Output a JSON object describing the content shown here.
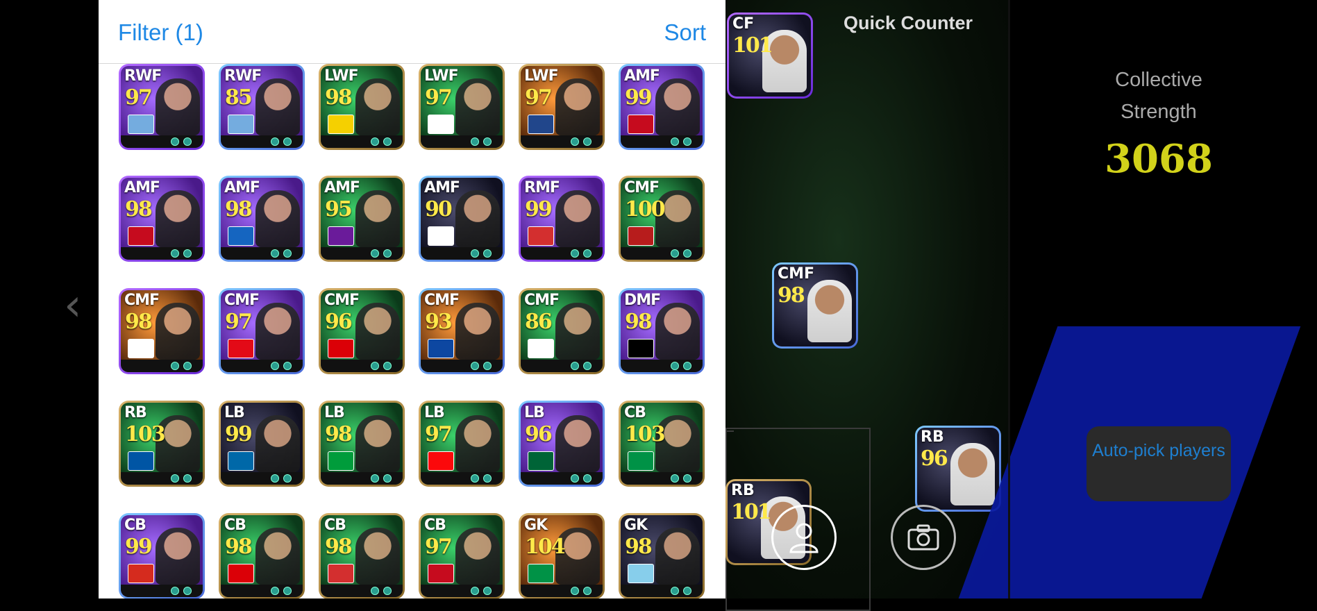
{
  "header": {
    "filter_label": "Filter (1)",
    "sort_label": "Sort"
  },
  "back_glyph": "‹",
  "grid": [
    {
      "pos": "RWF",
      "rating": "97",
      "frame": "purple",
      "bg": "purple",
      "badge": "#74acdf"
    },
    {
      "pos": "RWF",
      "rating": "85",
      "frame": "blue",
      "bg": "purple",
      "badge": "#74acdf"
    },
    {
      "pos": "LWF",
      "rating": "98",
      "frame": "gold",
      "bg": "green",
      "badge": "#f5d000"
    },
    {
      "pos": "LWF",
      "rating": "97",
      "frame": "gold",
      "bg": "green",
      "badge": "#ffffff"
    },
    {
      "pos": "LWF",
      "rating": "97",
      "frame": "gold",
      "bg": "orange",
      "badge": "#21468b"
    },
    {
      "pos": "AMF",
      "rating": "99",
      "frame": "blue",
      "bg": "purple",
      "badge": "#c60b1e"
    },
    {
      "pos": "AMF",
      "rating": "98",
      "frame": "purple",
      "bg": "purple",
      "badge": "#c60b1e"
    },
    {
      "pos": "AMF",
      "rating": "98",
      "frame": "blue",
      "bg": "purple",
      "badge": "#1565c0"
    },
    {
      "pos": "AMF",
      "rating": "95",
      "frame": "gold",
      "bg": "green",
      "badge": "#6a1b9a"
    },
    {
      "pos": "AMF",
      "rating": "90",
      "frame": "blue",
      "bg": "dark",
      "badge": "#ffffff"
    },
    {
      "pos": "RMF",
      "rating": "99",
      "frame": "purple",
      "bg": "purple",
      "badge": "#d32f2f"
    },
    {
      "pos": "CMF",
      "rating": "100",
      "frame": "gold",
      "bg": "green",
      "badge": "#b71c1c"
    },
    {
      "pos": "CMF",
      "rating": "98",
      "frame": "purple",
      "bg": "orange",
      "badge": "#ffffff"
    },
    {
      "pos": "CMF",
      "rating": "97",
      "frame": "blue",
      "bg": "purple",
      "badge": "#e30a17"
    },
    {
      "pos": "CMF",
      "rating": "96",
      "frame": "gold",
      "bg": "green",
      "badge": "#db0007"
    },
    {
      "pos": "CMF",
      "rating": "93",
      "frame": "blue",
      "bg": "orange",
      "badge": "#0d47a1"
    },
    {
      "pos": "CMF",
      "rating": "86",
      "frame": "gold",
      "bg": "green",
      "badge": "#ffffff"
    },
    {
      "pos": "DMF",
      "rating": "98",
      "frame": "blue",
      "bg": "purple",
      "badge": "#000000"
    },
    {
      "pos": "RB",
      "rating": "103",
      "frame": "gold",
      "bg": "green",
      "badge": "#0055a4"
    },
    {
      "pos": "LB",
      "rating": "99",
      "frame": "gold",
      "bg": "dark",
      "badge": "#0068a8"
    },
    {
      "pos": "LB",
      "rating": "98",
      "frame": "gold",
      "bg": "green",
      "badge": "#009c3b"
    },
    {
      "pos": "LB",
      "rating": "97",
      "frame": "gold",
      "bg": "green",
      "badge": "#fb090b"
    },
    {
      "pos": "LB",
      "rating": "96",
      "frame": "blue",
      "bg": "purple",
      "badge": "#006437"
    },
    {
      "pos": "CB",
      "rating": "103",
      "frame": "gold",
      "bg": "green",
      "badge": "#009246"
    },
    {
      "pos": "CB",
      "rating": "99",
      "frame": "blue",
      "bg": "purple",
      "badge": "#d52b1e"
    },
    {
      "pos": "CB",
      "rating": "98",
      "frame": "gold",
      "bg": "green",
      "badge": "#db0007"
    },
    {
      "pos": "CB",
      "rating": "98",
      "frame": "gold",
      "bg": "green",
      "badge": "#d32f2f"
    },
    {
      "pos": "CB",
      "rating": "97",
      "frame": "gold",
      "bg": "green",
      "badge": "#c60b1e"
    },
    {
      "pos": "GK",
      "rating": "104",
      "frame": "gold",
      "bg": "orange",
      "badge": "#009246"
    },
    {
      "pos": "GK",
      "rating": "98",
      "frame": "gold",
      "bg": "dark",
      "badge": "#87ceeb"
    }
  ],
  "pitch": {
    "title": "Quick Counter",
    "players": [
      {
        "pos": "CF",
        "rating": "101",
        "frame": "purple"
      },
      {
        "pos": "CMF",
        "rating": "98",
        "frame": "blue"
      },
      {
        "pos": "RB",
        "rating": "96",
        "frame": "blue"
      },
      {
        "pos": "RB",
        "rating": "101",
        "frame": "gold"
      }
    ]
  },
  "stats": {
    "label": "Collective Strength",
    "value": "3068",
    "auto_pick_label": "Auto-pick players"
  },
  "icons": {
    "person": "person-icon",
    "camera": "camera-icon",
    "back": "chevron-left-icon"
  },
  "colors": {
    "accent": "#1e88e5",
    "strength": "#d2d21a",
    "rating": "#ffe94a"
  }
}
